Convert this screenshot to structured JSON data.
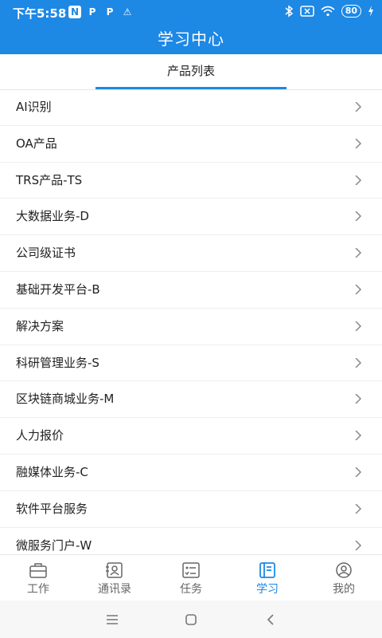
{
  "status": {
    "time": "下午5:58",
    "icons_left": [
      "N",
      "P",
      "P",
      "⚠"
    ],
    "battery": "80"
  },
  "header": {
    "title": "学习中心"
  },
  "tabs": [
    {
      "label": "产品列表",
      "active": true
    }
  ],
  "list": [
    {
      "label": "AI识别"
    },
    {
      "label": "OA产品"
    },
    {
      "label": "TRS产品-TS"
    },
    {
      "label": "大数据业务-D"
    },
    {
      "label": "公司级证书"
    },
    {
      "label": "基础开发平台-B"
    },
    {
      "label": "解决方案"
    },
    {
      "label": "科研管理业务-S"
    },
    {
      "label": "区块链商城业务-M"
    },
    {
      "label": "人力报价"
    },
    {
      "label": "融媒体业务-C"
    },
    {
      "label": "软件平台服务"
    },
    {
      "label": "微服务门户-W"
    }
  ],
  "bottom_nav": [
    {
      "label": "工作",
      "icon": "briefcase-icon",
      "active": false
    },
    {
      "label": "通讯录",
      "icon": "contacts-icon",
      "active": false
    },
    {
      "label": "任务",
      "icon": "checklist-icon",
      "active": false
    },
    {
      "label": "学习",
      "icon": "book-icon",
      "active": true
    },
    {
      "label": "我的",
      "icon": "profile-icon",
      "active": false
    }
  ],
  "colors": {
    "primary": "#1e88e5",
    "text": "#222222",
    "muted": "#666666"
  }
}
